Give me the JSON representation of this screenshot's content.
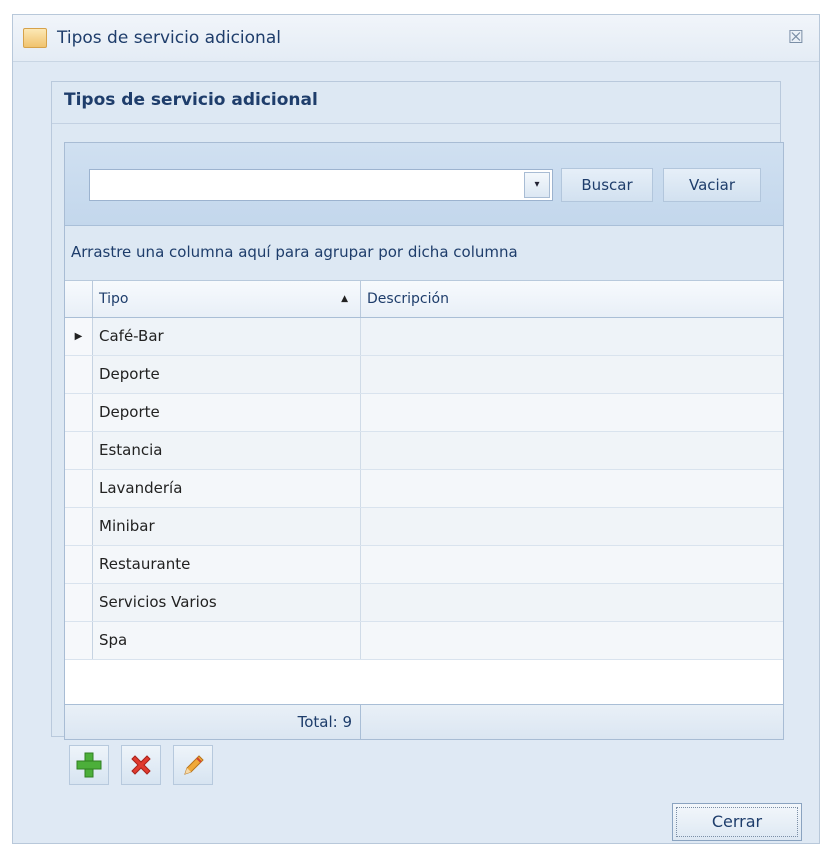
{
  "window": {
    "title": "Tipos de servicio adicional",
    "close_glyph": "☒"
  },
  "group": {
    "title": "Tipos de servicio adicional"
  },
  "search": {
    "value": "",
    "dropdown_glyph": "▾",
    "buscar_label": "Buscar",
    "vaciar_label": "Vaciar"
  },
  "grid": {
    "group_hint": "Arrastre una columna aquí para agrupar por dicha columna",
    "columns": {
      "tipo": "Tipo",
      "descripcion": "Descripción"
    },
    "sort_glyph": "▲",
    "current_row_glyph": "▶",
    "rows": [
      {
        "tipo": "Café-Bar",
        "descripcion": ""
      },
      {
        "tipo": "Deporte",
        "descripcion": ""
      },
      {
        "tipo": "Deporte",
        "descripcion": ""
      },
      {
        "tipo": "Estancia",
        "descripcion": ""
      },
      {
        "tipo": "Lavandería",
        "descripcion": ""
      },
      {
        "tipo": "Minibar",
        "descripcion": ""
      },
      {
        "tipo": "Restaurante",
        "descripcion": ""
      },
      {
        "tipo": "Servicios Varios",
        "descripcion": ""
      },
      {
        "tipo": "Spa",
        "descripcion": ""
      }
    ],
    "footer_total": "Total: 9"
  },
  "actions": {
    "add_icon": "plus-icon",
    "delete_icon": "x-icon",
    "edit_icon": "pencil-icon",
    "colors": {
      "add": "#4caf3a",
      "delete": "#e03a2f",
      "edit": "#f0a93a"
    }
  },
  "footer": {
    "cerrar_label": "Cerrar"
  }
}
